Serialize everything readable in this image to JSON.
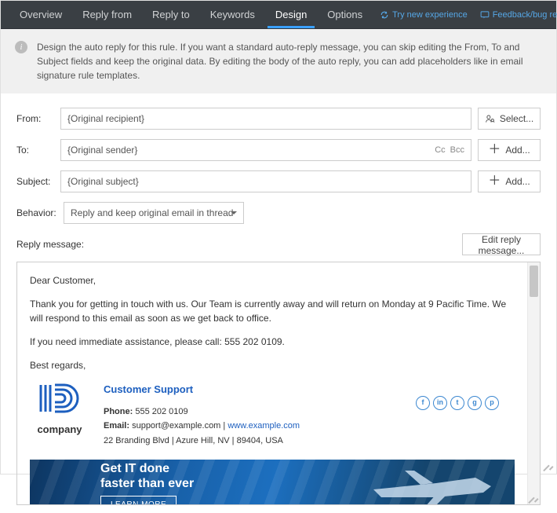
{
  "nav": {
    "tabs": [
      "Overview",
      "Reply from",
      "Reply to",
      "Keywords",
      "Design",
      "Options"
    ],
    "active_index": 4,
    "try_link": "Try new experience",
    "feedback_link": "Feedback/bug report"
  },
  "info": {
    "text": "Design the auto reply for this rule. If you want a standard auto-reply message, you can skip editing the From, To and Subject fields and keep the original data. By editing the body of the auto reply, you can add placeholders like in email signature rule templates."
  },
  "form": {
    "from_label": "From:",
    "from_value": "{Original recipient}",
    "from_btn": "Select...",
    "to_label": "To:",
    "to_value": "{Original sender}",
    "cc_label": "Cc",
    "bcc_label": "Bcc",
    "to_btn": "Add...",
    "subject_label": "Subject:",
    "subject_value": "{Original subject}",
    "subject_btn": "Add...",
    "behavior_label": "Behavior:",
    "behavior_value": "Reply and keep original email in thread"
  },
  "reply": {
    "section_label": "Reply message:",
    "edit_btn": "Edit reply message..."
  },
  "message": {
    "greeting": "Dear Customer,",
    "body1": "Thank you for getting in touch with us. Our Team is currently away and will return on Monday at 9 Pacific Time. We will respond to this email as soon as we get back to office.",
    "body2": "If you need immediate assistance, please call: 555 202 0109.",
    "closing": "Best regards,"
  },
  "signature": {
    "logo_word": "company",
    "name": "Customer Support",
    "phone_label": "Phone:",
    "phone": "555 202 0109",
    "email_label": "Email:",
    "email": "support@example.com",
    "website": "www.example.com",
    "address": "22 Branding Blvd | Azure Hill, NV | 89404, USA",
    "social": [
      "f",
      "in",
      "t",
      "g",
      "p"
    ]
  },
  "banner": {
    "title1": "Get IT done",
    "title2": "faster than ever",
    "cta": "LEARN MORE"
  }
}
